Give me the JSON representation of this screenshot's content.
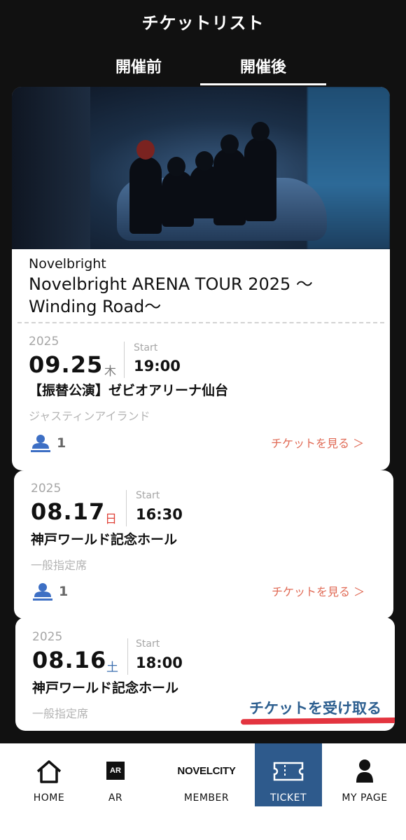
{
  "header": {
    "title": "チケットリスト"
  },
  "tabs": [
    {
      "label": "開催前",
      "active": false
    },
    {
      "label": "開催後",
      "active": true
    }
  ],
  "tickets": [
    {
      "artist": "Novelbright",
      "event_title": "Novelbright ARENA TOUR 2025 〜Winding Road〜",
      "year": "2025",
      "date": "09.25",
      "day_of_week": "木",
      "day_color": "#7a7a7a",
      "start_label": "Start",
      "start_time": "19:00",
      "venue": "【振替公演】ゼビオアリーナ仙台",
      "seat_type": "ジャスティンアイランド",
      "ticket_count": "1",
      "action_label": "チケットを見る ＞"
    },
    {
      "year": "2025",
      "date": "08.17",
      "day_of_week": "日",
      "day_color": "#e0443a",
      "start_label": "Start",
      "start_time": "16:30",
      "venue": "神戸ワールド記念ホール",
      "seat_type": "一般指定席",
      "ticket_count": "1",
      "action_label": "チケットを見る ＞"
    },
    {
      "year": "2025",
      "date": "08.16",
      "day_of_week": "土",
      "day_color": "#3d6fb0",
      "start_label": "Start",
      "start_time": "18:00",
      "venue": "神戸ワールド記念ホール",
      "seat_type": "一般指定席",
      "action_label": "チケットを受け取る"
    }
  ],
  "bottom_nav": {
    "home": "HOME",
    "ar_badge": "AR",
    "ar": "AR",
    "member_logo": "NOVELCITY",
    "member": "MEMBER",
    "ticket": "TICKET",
    "mypage": "MY PAGE",
    "active": "ticket"
  },
  "colors": {
    "background": "#111111",
    "accent_link": "#e06a55",
    "receive_link": "#2c5e8f",
    "nav_active": "#2e5a8c",
    "user_icon": "#3d6fc4",
    "highlight_underline": "#e3343f"
  }
}
